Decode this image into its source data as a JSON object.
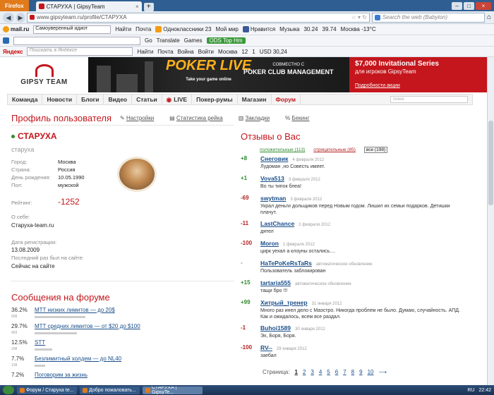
{
  "browser": {
    "ff_label": "Firefox",
    "tab_title": "СТАРУХА | GipsyTeam",
    "url": "www.gipsyteam.ru/profile/СТАРУХА",
    "search_placeholder": "Search the web (Babylon)"
  },
  "toolbar1": {
    "mail": "mail.ru",
    "search_hint": "Самоуверенный идиот",
    "find": "Найти",
    "items": [
      "Почта",
      "Одноклассники 23",
      "Мой мир",
      "Нравится",
      "Музыка",
      "30.24",
      "39.74",
      "Москва -13°C"
    ]
  },
  "toolbar2": {
    "go": "Go",
    "translate": "Translate",
    "games": "Games",
    "green": "ODS Top Hm"
  },
  "toolbar3": {
    "yandex": "Яндекс",
    "placeholder": "Поискать в Яндексе",
    "find": "Найти",
    "mail": "Почта",
    "war": "Война",
    "login": "Войти",
    "city": "Москва",
    "num": "12",
    "num2": "1",
    "usd": "USD 30,24"
  },
  "banner": {
    "logo": "GIPSY TEAM",
    "poker": "POKER LIVE",
    "tag": "Take your game online",
    "together": "СОВМЕСТНО С",
    "pcm": "POKER CLUB MANAGEMENT",
    "right1": "$7,000 Invitational Series",
    "right2": "для игроков GipsyTeam",
    "right3": "Подробности акции"
  },
  "mainnav": {
    "items": [
      "Команда",
      "Новости",
      "Блоги",
      "Видео",
      "Статьи",
      "LIVE",
      "Покер-румы",
      "Магазин",
      "Форум"
    ],
    "search_placeholder": "поиск"
  },
  "profile": {
    "title": "Профиль пользователя",
    "tabs": [
      "Настройки",
      "Статистика рейка",
      "Закладки",
      "Бекинг"
    ],
    "username": "СТАРУХА",
    "login": "старуха",
    "fields": [
      {
        "l": "Город:",
        "v": "Москва"
      },
      {
        "l": "Страна:",
        "v": "Россия"
      },
      {
        "l": "День рождения:",
        "v": "10.05.1990"
      },
      {
        "l": "Пол:",
        "v": "мужской"
      }
    ],
    "rating_label": "Рейтинг:",
    "rating": "-1252",
    "about_label": "О себе:",
    "about": "Старуха-team.ru",
    "reg_label": "Дата регистрации:",
    "reg": "13.08.2009",
    "last_label": "Последний раз был на сайте:",
    "last": "Сейчас на сайте"
  },
  "forum": {
    "title": "Сообщения на форуме",
    "items": [
      {
        "pct": "36.2%",
        "name": "MTT низких лимитов — до 20$",
        "count": "608",
        "fill": 0.36
      },
      {
        "pct": "29.7%",
        "name": "MTT средних лимитов — от $20 до $100",
        "count": "493",
        "fill": 0.3
      },
      {
        "pct": "12.5%",
        "name": "STT",
        "count": "208",
        "fill": 0.125
      },
      {
        "pct": "7.7%",
        "name": "Безлимитный холдем — до NL40",
        "count": "128",
        "fill": 0.077
      },
      {
        "pct": "7.2%",
        "name": "Поговорим за жизнь",
        "count": "",
        "fill": 0.072
      }
    ]
  },
  "reviews": {
    "title": "Отзывы о Вас",
    "filters": [
      "положительные (113)",
      "отрицательные (85)",
      "все (198)"
    ],
    "items": [
      {
        "score": "+8",
        "name": "Снеговик",
        "date": "4 февраля 2012",
        "text": "Лудоман ,но Совесть имеет."
      },
      {
        "score": "+1",
        "name": "Vova513",
        "date": "3 февраля 2012",
        "text": "Во ты типок блеа!"
      },
      {
        "score": "-69",
        "name": "swytman",
        "date": "3 февраля 2012",
        "text": "Украл деньги дольщиков перед Новым годом. Лишил их семьи подарков. Детишки плачут."
      },
      {
        "score": "-11",
        "name": "LastChance",
        "date": "2 февраля 2012",
        "text": "дятел"
      },
      {
        "score": "-100",
        "name": "Moron",
        "date": "1 февраля 2012",
        "text": "цирк уехал а клоуны остались...."
      },
      {
        "score": "-",
        "name": "HaTePoKeRsTaRs",
        "date": "автоматическое обновление",
        "text": "Пользователь заблокирован"
      },
      {
        "score": "+15",
        "name": "tartaria555",
        "date": "автоматическое обновление",
        "text": "тащи бро !!!"
      },
      {
        "score": "+99",
        "name": "Хитрый_тренер",
        "date": "31 января 2012",
        "text": "Много раз инел дело с Маэстро. Никогда проблем не было. Думаю, случайность. АПД. Как и ожидалось, всем все раздал."
      },
      {
        "score": "-1",
        "name": "Buhoi1589",
        "date": "30 января 2012",
        "text": "Эх, Боря, Боря."
      },
      {
        "score": "-100",
        "name": "RV--",
        "date": "29 января 2012",
        "text": "заебал"
      }
    ]
  },
  "pager": {
    "label": "Страница:",
    "pages": [
      "1",
      "2",
      "3",
      "4",
      "5",
      "6",
      "7",
      "8",
      "9",
      "10"
    ],
    "next": "⟶"
  },
  "taskbar": {
    "tasks": [
      "Форум / Старуха te...",
      "Добро пожаловать...",
      "СТАРУХА | GipsyTe..."
    ],
    "lang": "RU",
    "time": "22:42"
  },
  "colors": {
    "accent": "#c4161c",
    "positive": "#2e8b2e",
    "negative": "#b22222",
    "link": "#1a4f8a"
  }
}
